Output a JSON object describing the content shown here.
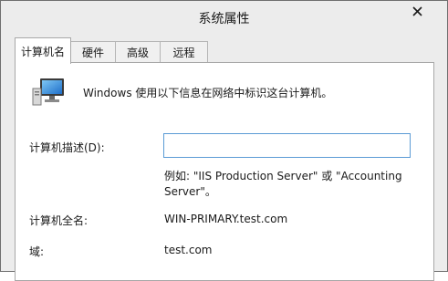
{
  "window": {
    "title": "系统属性"
  },
  "tabs": [
    {
      "label": "计算机名",
      "active": true
    },
    {
      "label": "硬件",
      "active": false
    },
    {
      "label": "高级",
      "active": false
    },
    {
      "label": "远程",
      "active": false
    }
  ],
  "panel": {
    "intro_text": "Windows 使用以下信息在网络中标识这台计算机。",
    "icon": "computer-icon",
    "description": {
      "label": "计算机描述(D):",
      "value": "",
      "example_line1": "例如: \"IIS Production Server\" 或 \"Accounting",
      "example_line2": "Server\"。"
    },
    "full_name": {
      "label": "计算机全名:",
      "value": "WIN-PRIMARY.test.com"
    },
    "domain": {
      "label": "域:",
      "value": "test.com"
    }
  },
  "colors": {
    "window_bg": "#ececec",
    "panel_bg": "#ffffff",
    "input_border": "#5b9bd5"
  }
}
